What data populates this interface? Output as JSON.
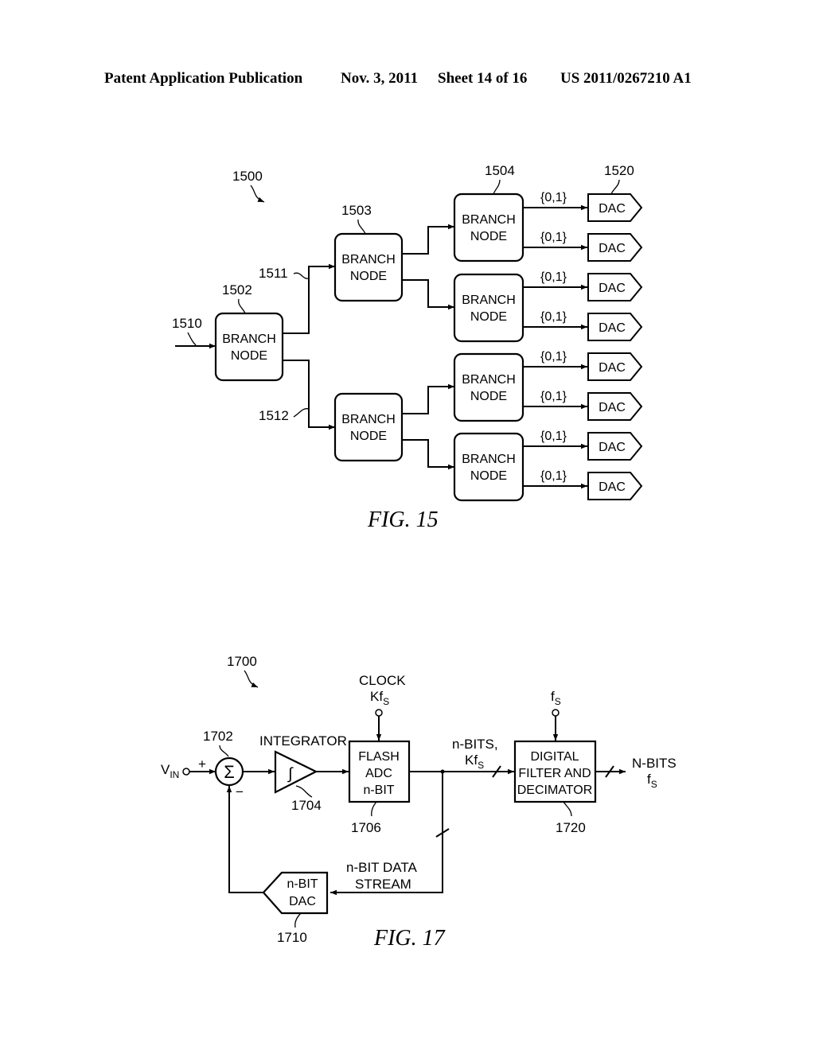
{
  "header": {
    "publication": "Patent Application Publication",
    "date": "Nov. 3, 2011",
    "sheet": "Sheet 14 of 16",
    "number": "US 2011/0267210 A1"
  },
  "fig15": {
    "caption": "FIG. 15",
    "ref_system": "1500",
    "ref_root": "1502",
    "ref_level2": "1503",
    "ref_level3": "1504",
    "ref_dac": "1520",
    "ref_input": "1510",
    "ref_upper_path": "1511",
    "ref_lower_path": "1512",
    "node_line1": "BRANCH",
    "node_line2": "NODE",
    "signal_label": "{0,1}",
    "dac_label": "DAC"
  },
  "fig17": {
    "caption": "FIG. 17",
    "ref_system": "1700",
    "ref_summer": "1702",
    "ref_integrator": "1704",
    "ref_adc": "1706",
    "ref_dac": "1710",
    "ref_filter": "1720",
    "input_label": "V",
    "input_sub": "IN",
    "plus": "+",
    "minus": "−",
    "sigma": "Σ",
    "integral": "∫",
    "integrator_label": "INTEGRATOR",
    "clock_line1": "CLOCK",
    "clock_line2": "Kf",
    "clock_sub": "S",
    "adc_line1": "FLASH",
    "adc_line2": "ADC",
    "adc_line3": "n-BIT",
    "bus_line1": "n-BITS,",
    "bus_line2": "Kf",
    "bus_sub": "S",
    "fs_label": "f",
    "fs_sub": "S",
    "filter_line1": "DIGITAL",
    "filter_line2": "FILTER AND",
    "filter_line3": "DECIMATOR",
    "out_line1": "N-BITS",
    "out_line2": "f",
    "out_sub": "S",
    "stream_line1": "n-BIT DATA",
    "stream_line2": "STREAM",
    "dac_line1": "n-BIT",
    "dac_line2": "DAC"
  }
}
